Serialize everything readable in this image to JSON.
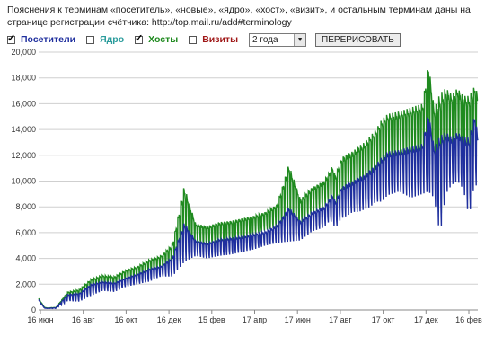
{
  "note": "Пояснения к терминам «посетитель», «новые», «ядро», «хост», «визит», и остальным терминам даны на странице регистрации счётчика: http://top.mail.ru/add#terminology",
  "controls": {
    "visitors": {
      "label": "Посетители",
      "checked": true,
      "color": "#1f2f9e"
    },
    "core": {
      "label": "Ядро",
      "checked": false,
      "color": "#2b9c9c"
    },
    "hosts": {
      "label": "Хосты",
      "checked": true,
      "color": "#1f8a1f"
    },
    "visits": {
      "label": "Визиты",
      "checked": false,
      "color": "#a01818"
    },
    "period": "2 года",
    "redraw_label": "ПЕРЕРИСОВАТЬ"
  },
  "chart_data": {
    "type": "line",
    "ylim": [
      0,
      20000
    ],
    "yticks": [
      "0",
      "2,000",
      "4,000",
      "6,000",
      "8,000",
      "10,000",
      "12,000",
      "14,000",
      "16,000",
      "18,000",
      "20,000"
    ],
    "xticks": [
      "16 июн",
      "16 авг",
      "16 окт",
      "16 дек",
      "15 фев",
      "17 апр",
      "17 июн",
      "17 авг",
      "17 окт",
      "17 дек",
      "16 фев"
    ],
    "grid": true,
    "series": [
      {
        "name": "Хосты",
        "color": "#1f8a1f",
        "x": [
          0,
          2,
          3,
          6,
          10,
          14,
          18,
          22,
          26,
          30,
          34,
          38,
          42,
          46,
          50,
          54,
          58,
          62,
          66,
          70,
          74,
          78,
          82,
          86,
          90,
          94,
          98,
          100,
          101,
          102,
          104,
          106,
          108,
          110,
          112,
          114,
          116,
          118,
          120,
          124,
          128,
          132,
          134,
          136,
          138,
          140,
          142,
          144,
          146,
          148,
          150,
          151
        ],
        "low": [
          800,
          200,
          150,
          150,
          900,
          800,
          1400,
          1800,
          1700,
          2200,
          2400,
          2700,
          3200,
          3200,
          4600,
          5100,
          4900,
          5200,
          5300,
          5500,
          5800,
          6200,
          6400,
          6400,
          6600,
          7500,
          7900,
          8400,
          8300,
          7800,
          8700,
          9000,
          9400,
          9300,
          9600,
          9800,
          10400,
          10400,
          11000,
          11400,
          10800,
          11200,
          11400,
          10800,
          6400,
          11200,
          12000,
          12400,
          11600,
          10400,
          12400,
          11400
        ],
        "high": [
          900,
          200,
          150,
          200,
          1400,
          1600,
          2400,
          2700,
          2600,
          3100,
          3400,
          3900,
          4200,
          5100,
          9600,
          6700,
          6500,
          6800,
          6900,
          7100,
          7300,
          7600,
          8200,
          11300,
          8600,
          9500,
          10000,
          10700,
          11200,
          10400,
          11800,
          12100,
          12300,
          12700,
          13000,
          13500,
          14000,
          14800,
          15200,
          15400,
          15700,
          16000,
          19200,
          15600,
          16800,
          17200,
          16700,
          17200,
          16600,
          16600,
          17400,
          16700
        ]
      },
      {
        "name": "Посетители",
        "color": "#1f2f9e",
        "x": [
          0,
          2,
          3,
          6,
          10,
          14,
          18,
          22,
          26,
          30,
          34,
          38,
          42,
          46,
          50,
          54,
          58,
          62,
          66,
          70,
          74,
          78,
          82,
          86,
          90,
          94,
          98,
          100,
          101,
          102,
          104,
          106,
          108,
          110,
          112,
          114,
          116,
          118,
          120,
          124,
          128,
          132,
          134,
          136,
          138,
          140,
          142,
          144,
          146,
          148,
          150,
          151
        ],
        "low": [
          700,
          150,
          120,
          120,
          700,
          650,
          1100,
          1500,
          1400,
          1800,
          2000,
          2200,
          2600,
          2600,
          3700,
          4200,
          4000,
          4200,
          4300,
          4500,
          4700,
          5000,
          5200,
          5300,
          5400,
          6100,
          6400,
          6900,
          6800,
          6300,
          7100,
          7300,
          7600,
          7600,
          7800,
          8000,
          8400,
          8400,
          8900,
          9200,
          8700,
          9000,
          9200,
          8700,
          5800,
          9000,
          9700,
          10000,
          9400,
          7200,
          10000,
          9200
        ],
        "high": [
          800,
          150,
          120,
          170,
          1200,
          1300,
          2000,
          2200,
          2100,
          2500,
          2800,
          3200,
          3400,
          4100,
          6800,
          5400,
          5200,
          5500,
          5600,
          5700,
          5900,
          6100,
          6600,
          8000,
          6900,
          7600,
          8000,
          8600,
          9000,
          8400,
          9500,
          9800,
          10000,
          10300,
          10500,
          10900,
          11300,
          11900,
          12300,
          12400,
          12700,
          12900,
          15400,
          12600,
          13500,
          13800,
          13400,
          13800,
          13400,
          13400,
          15200,
          13500
        ]
      }
    ]
  }
}
